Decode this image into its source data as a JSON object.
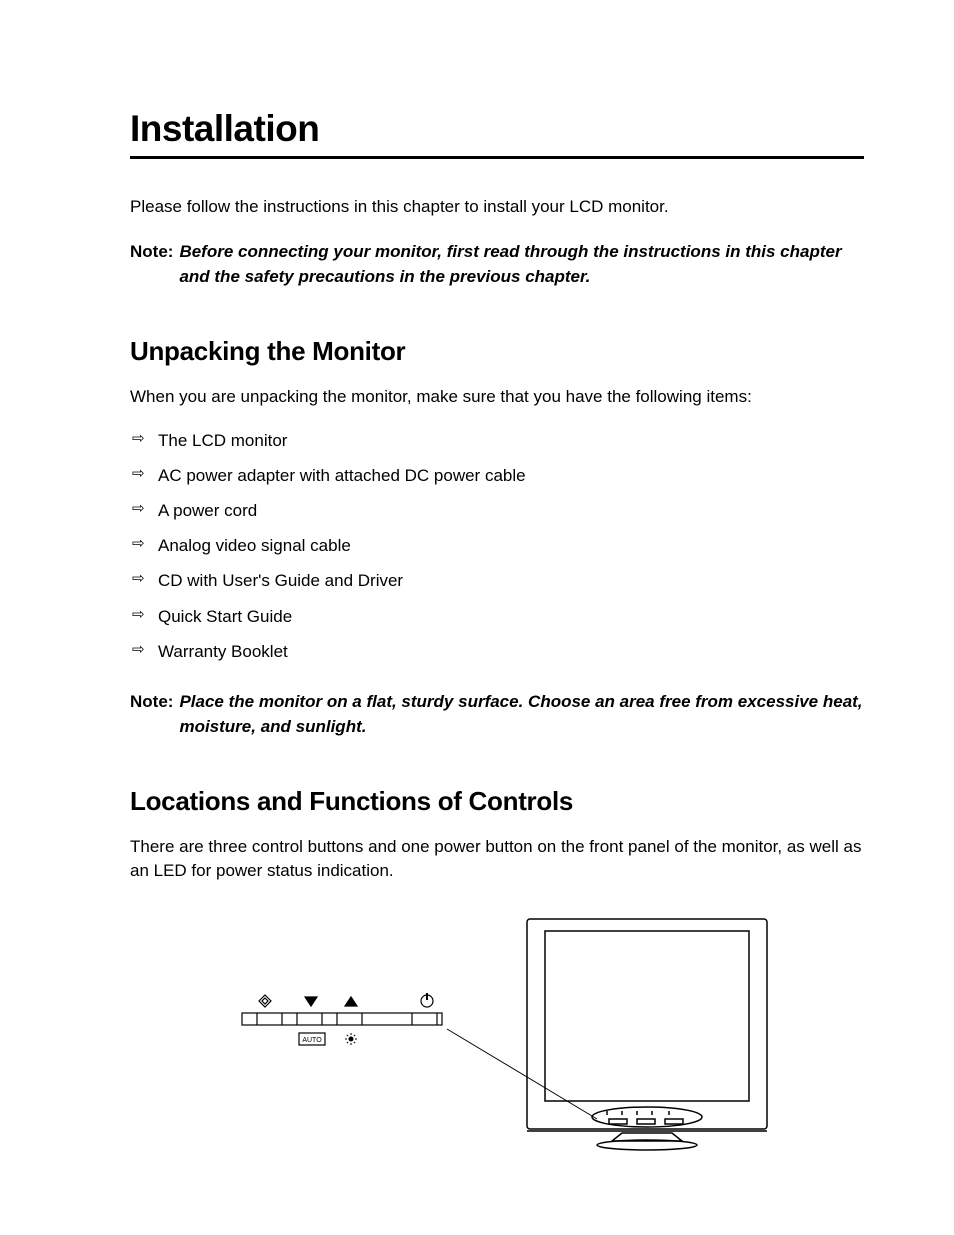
{
  "title": "Installation",
  "intro": "Please follow the instructions in this chapter to install your LCD monitor.",
  "note1": {
    "label": "Note:",
    "text": "Before connecting your monitor, first read through the instructions in this chapter and the safety precautions in the previous chapter."
  },
  "section1": {
    "heading": "Unpacking the Monitor",
    "lead": "When you are unpacking the monitor, make sure that you have the following items:",
    "items": [
      "The LCD monitor",
      "AC power adapter with attached DC power cable",
      "A power cord",
      "Analog video signal cable",
      "CD with User's Guide and Driver",
      "Quick Start Guide",
      "Warranty Booklet"
    ]
  },
  "note2": {
    "label": "Note:",
    "text": "Place the monitor on a flat, sturdy surface. Choose an area free from excessive heat, moisture, and sunlight."
  },
  "section2": {
    "heading": "Locations and Functions of Controls",
    "lead": "There are three control buttons and one power button on the front panel of the monitor, as well as an LED for power status indication."
  },
  "figure": {
    "auto_label": "AUTO"
  }
}
